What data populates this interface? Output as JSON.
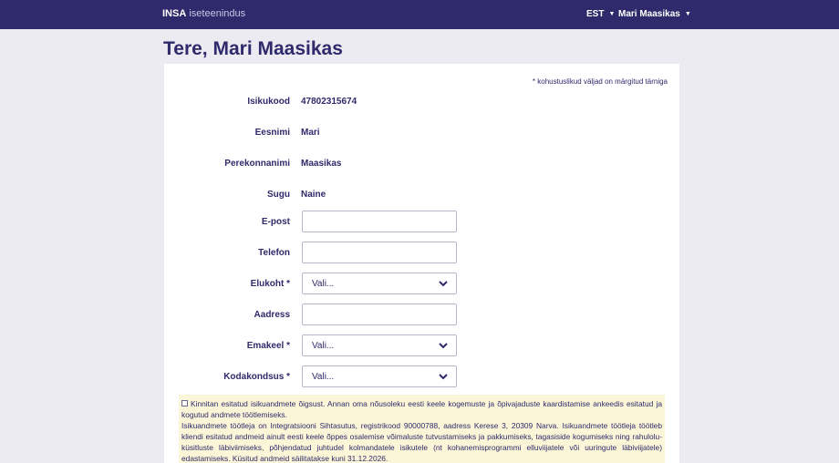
{
  "header": {
    "brand_bold": "INSA",
    "brand_light": "iseteenindus",
    "language": "EST",
    "user_name": "Mari Maasikas"
  },
  "page": {
    "greeting": "Tere, Mari Maasikas"
  },
  "form": {
    "required_note": "* kohustuslikud väljad on märgitud tärniga",
    "isikukood": {
      "label": "Isikukood",
      "value": "47802315674"
    },
    "eesnimi": {
      "label": "Eesnimi",
      "value": "Mari"
    },
    "perekonnanimi": {
      "label": "Perekonnanimi",
      "value": "Maasikas"
    },
    "sugu": {
      "label": "Sugu",
      "value": "Naine"
    },
    "epost": {
      "label": "E-post",
      "value": ""
    },
    "telefon": {
      "label": "Telefon",
      "value": ""
    },
    "elukoht": {
      "label": "Elukoht *",
      "selected": "Vali..."
    },
    "aadress": {
      "label": "Aadress",
      "value": ""
    },
    "emakeel": {
      "label": "Emakeel *",
      "selected": "Vali..."
    },
    "kodakondsus": {
      "label": "Kodakondsus *",
      "selected": "Vali..."
    }
  },
  "consent": {
    "checkbox_text": "Kinnitan esitatud isikuandmete õigsust. Annan oma nõusoleku eesti keele kogemuste ja õpivajaduste kaardistamise ankeedis esitatud ja kogutud andmete töötlemiseks.",
    "info_text": "Isikuandmete töötleja on Integratsiooni Sihtasutus, registrikood 90000788, aadress Kerese 3, 20309 Narva. Isikuandmete töötleja töötleb kliendi esitatud andmeid ainult eesti keele õppes osalemise võimaluste tutvustamiseks ja pakkumiseks, tagasiside kogumiseks ning rahulolu­küsitluste läbiviimiseks, põhjendatud juhtudel kolmandatele isikutele (nt kohanemisprogrammi elluviijatele või uuringute läbiviijatele) edastamiseks. Küsitud andmeid säilitatakse kuni 31.12.2026."
  },
  "colors": {
    "primary": "#2e2a6b",
    "background": "#ecebf2",
    "consent_bg": "#fcf6d8"
  }
}
